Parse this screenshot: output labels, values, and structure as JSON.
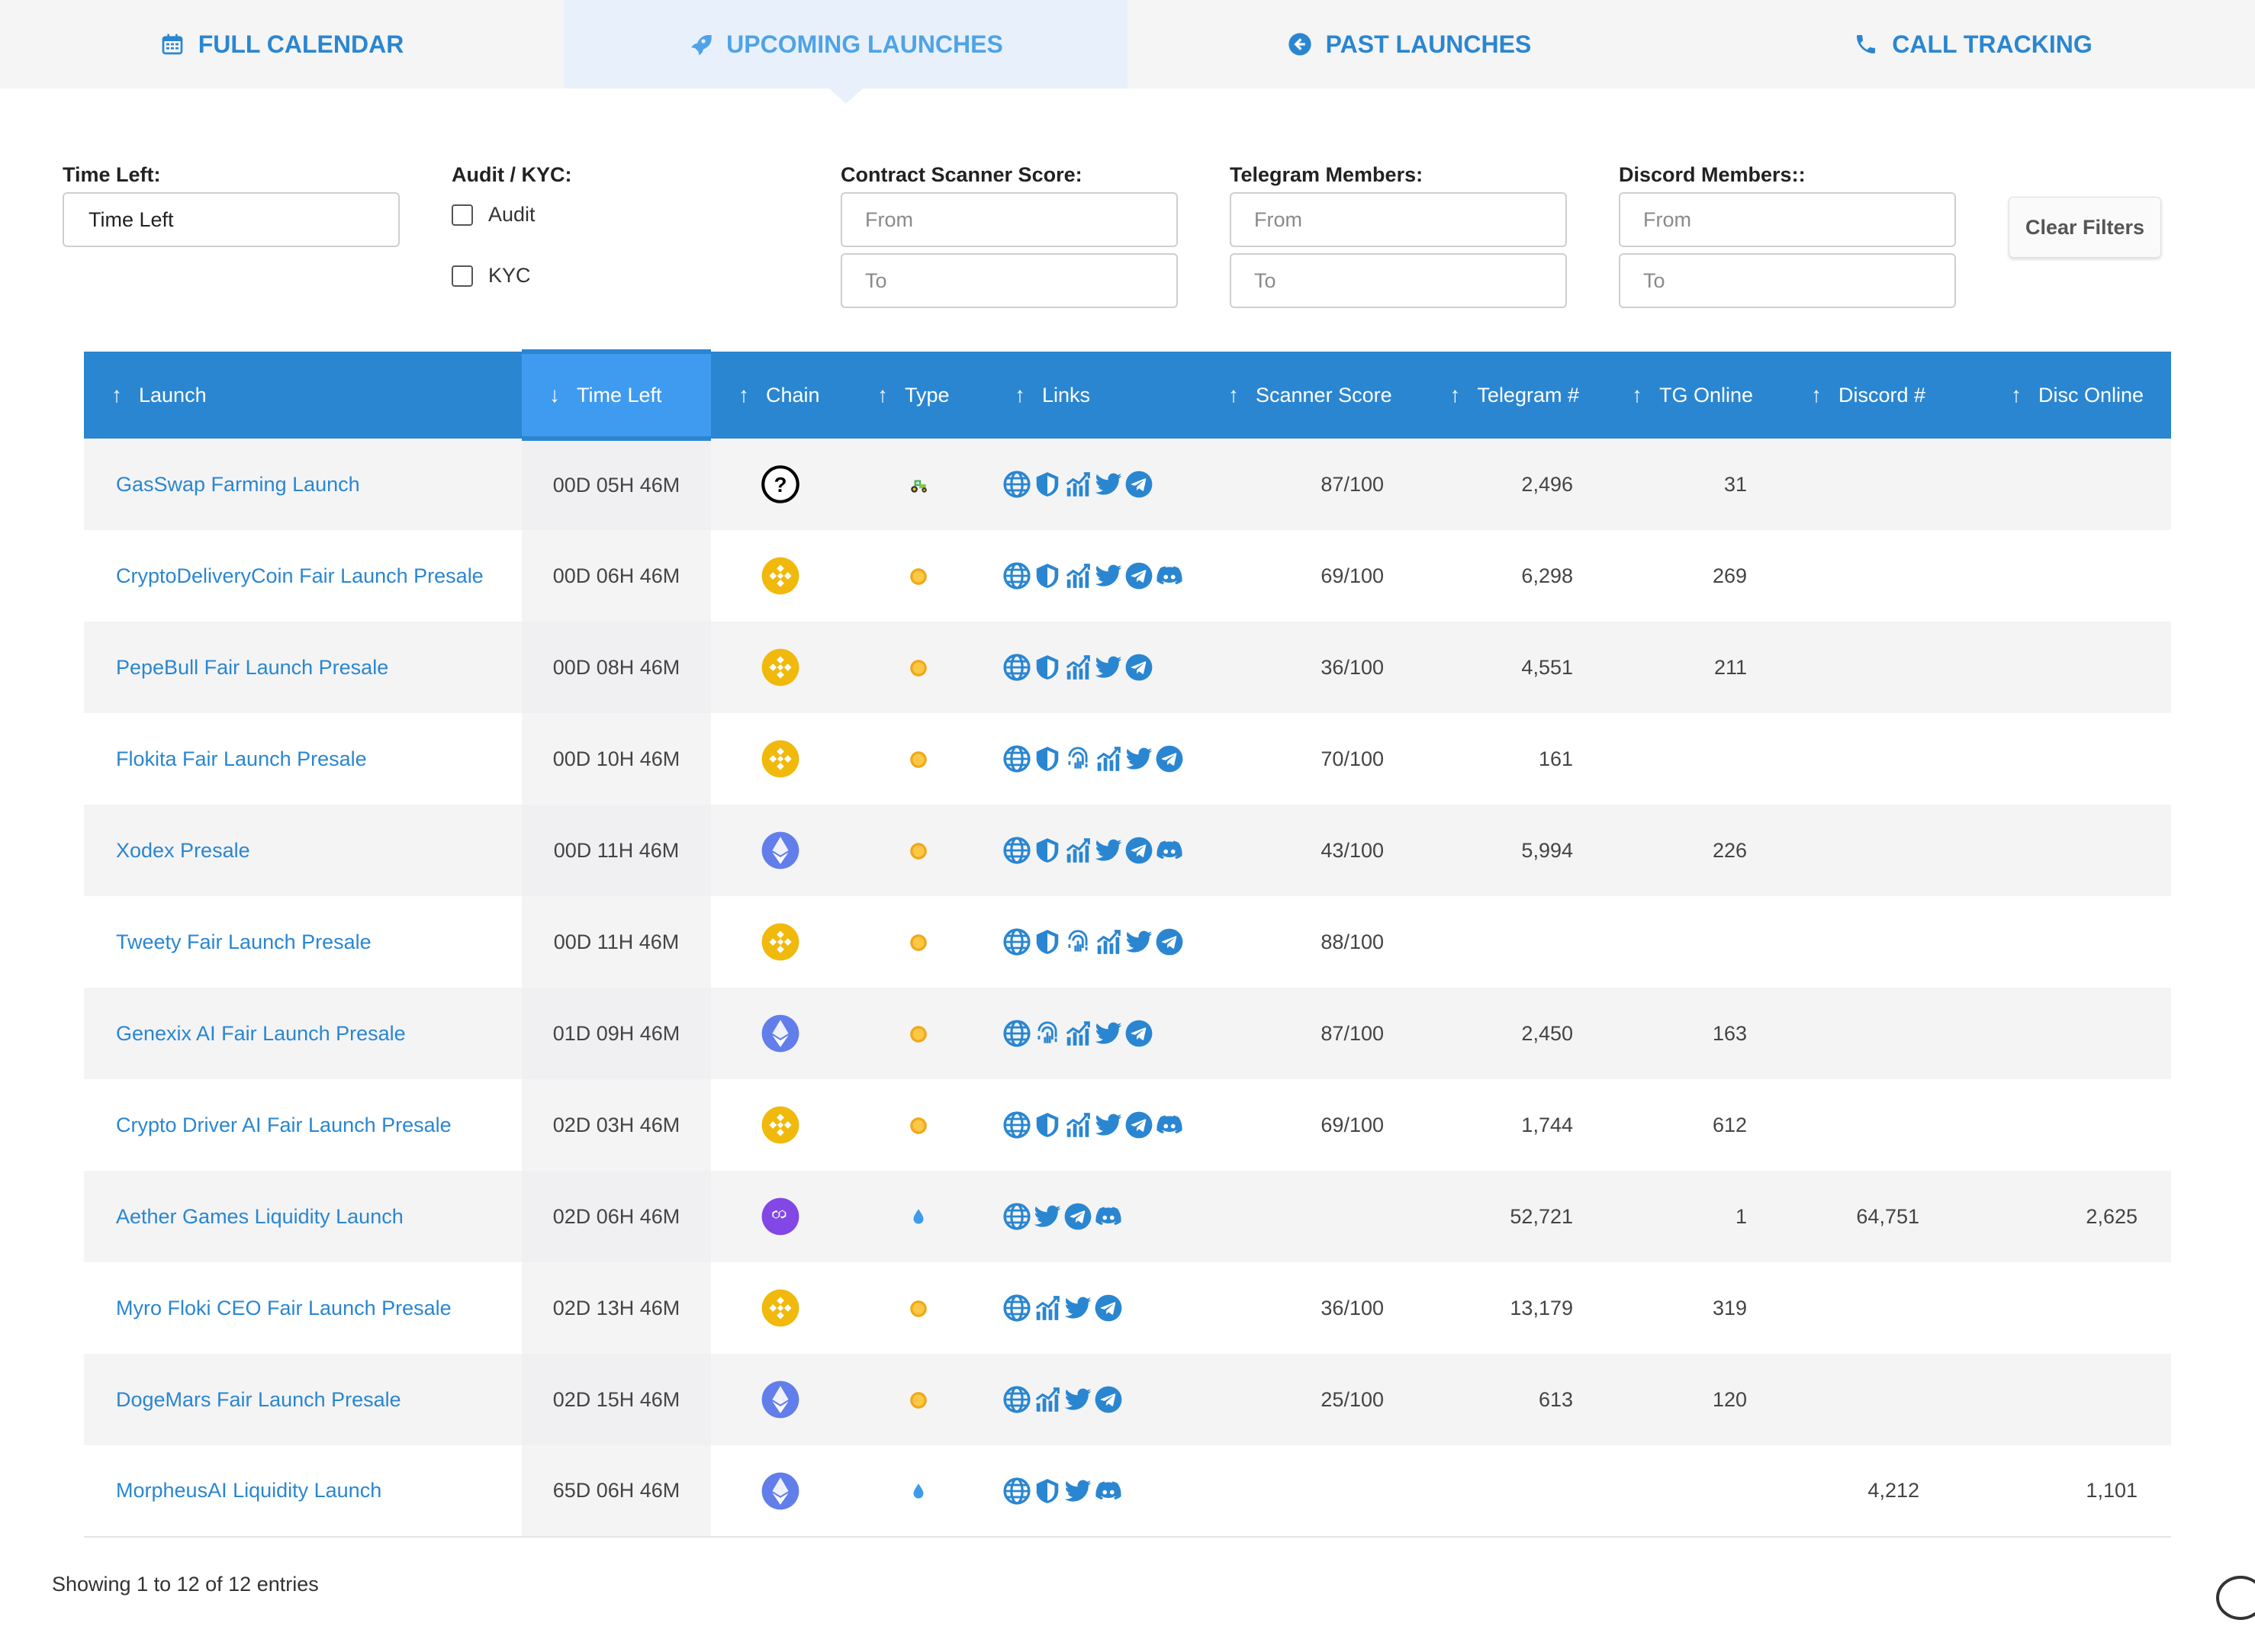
{
  "tabs": [
    {
      "label": "FULL CALENDAR",
      "icon": "calendar-icon",
      "active": false
    },
    {
      "label": "UPCOMING LAUNCHES",
      "icon": "rocket-icon",
      "active": true
    },
    {
      "label": "PAST LAUNCHES",
      "icon": "arrow-circle-left-icon",
      "active": false
    },
    {
      "label": "CALL TRACKING",
      "icon": "phone-icon",
      "active": false
    }
  ],
  "filters": {
    "time_left": {
      "label": "Time Left:",
      "value": "Time Left"
    },
    "audit_kyc": {
      "label": "Audit / KYC:",
      "audit": "Audit",
      "kyc": "KYC"
    },
    "scanner": {
      "label": "Contract Scanner Score:",
      "from_placeholder": "From",
      "to_placeholder": "To"
    },
    "telegram": {
      "label": "Telegram Members:",
      "from_placeholder": "From",
      "to_placeholder": "To"
    },
    "discord": {
      "label": "Discord Members::",
      "from_placeholder": "From",
      "to_placeholder": "To"
    },
    "clear": "Clear Filters"
  },
  "table": {
    "columns": [
      "Launch",
      "Time Left",
      "Chain",
      "Type",
      "Links",
      "Scanner Score",
      "Telegram #",
      "TG Online",
      "Discord #",
      "Disc Online"
    ],
    "sort_arrows": [
      "↑",
      "↓",
      "↑",
      "↑",
      "↑",
      "↑",
      "↑",
      "↑",
      "↑",
      "↑"
    ],
    "rows": [
      {
        "name": "GasSwap Farming Launch",
        "time": "00D 05H 46M",
        "chain": "unknown",
        "type": "farm",
        "links": [
          "globe",
          "shield",
          "chart",
          "twitter",
          "telegram"
        ],
        "score": "87/100",
        "tg": "2,496",
        "tg_online": "31",
        "discord": "",
        "disc_online": ""
      },
      {
        "name": "CryptoDeliveryCoin Fair Launch Presale",
        "time": "00D 06H 46M",
        "chain": "bnb",
        "type": "coin",
        "links": [
          "globe",
          "shield",
          "chart",
          "twitter",
          "telegram",
          "discord"
        ],
        "score": "69/100",
        "tg": "6,298",
        "tg_online": "269",
        "discord": "",
        "disc_online": ""
      },
      {
        "name": "PepeBull Fair Launch Presale",
        "time": "00D 08H 46M",
        "chain": "bnb",
        "type": "coin",
        "links": [
          "globe",
          "shield",
          "chart",
          "twitter",
          "telegram"
        ],
        "score": "36/100",
        "tg": "4,551",
        "tg_online": "211",
        "discord": "",
        "disc_online": ""
      },
      {
        "name": "Flokita Fair Launch Presale",
        "time": "00D 10H 46M",
        "chain": "bnb",
        "type": "coin",
        "links": [
          "globe",
          "shield",
          "fingerprint",
          "chart",
          "twitter",
          "telegram"
        ],
        "score": "70/100",
        "tg": "161",
        "tg_online": "",
        "discord": "",
        "disc_online": ""
      },
      {
        "name": "Xodex Presale",
        "time": "00D 11H 46M",
        "chain": "eth",
        "type": "coin",
        "links": [
          "globe",
          "shield",
          "chart",
          "twitter",
          "telegram",
          "discord"
        ],
        "score": "43/100",
        "tg": "5,994",
        "tg_online": "226",
        "discord": "",
        "disc_online": ""
      },
      {
        "name": "Tweety Fair Launch Presale",
        "time": "00D 11H 46M",
        "chain": "bnb",
        "type": "coin",
        "links": [
          "globe",
          "shield",
          "fingerprint",
          "chart",
          "twitter",
          "telegram"
        ],
        "score": "88/100",
        "tg": "",
        "tg_online": "",
        "discord": "",
        "disc_online": ""
      },
      {
        "name": "Genexix AI Fair Launch Presale",
        "time": "01D 09H 46M",
        "chain": "eth",
        "type": "coin",
        "links": [
          "globe",
          "fingerprint",
          "chart",
          "twitter",
          "telegram"
        ],
        "score": "87/100",
        "tg": "2,450",
        "tg_online": "163",
        "discord": "",
        "disc_online": ""
      },
      {
        "name": "Crypto Driver AI Fair Launch Presale",
        "time": "02D 03H 46M",
        "chain": "bnb",
        "type": "coin",
        "links": [
          "globe",
          "shield",
          "chart",
          "twitter",
          "telegram",
          "discord"
        ],
        "score": "69/100",
        "tg": "1,744",
        "tg_online": "612",
        "discord": "",
        "disc_online": ""
      },
      {
        "name": "Aether Games Liquidity Launch",
        "time": "02D 06H 46M",
        "chain": "polygon",
        "type": "drop",
        "links": [
          "globe",
          "twitter",
          "telegram",
          "discord"
        ],
        "score": "",
        "tg": "52,721",
        "tg_online": "1",
        "discord": "64,751",
        "disc_online": "2,625"
      },
      {
        "name": "Myro Floki CEO Fair Launch Presale",
        "time": "02D 13H 46M",
        "chain": "bnb",
        "type": "coin",
        "links": [
          "globe",
          "chart",
          "twitter",
          "telegram"
        ],
        "score": "36/100",
        "tg": "13,179",
        "tg_online": "319",
        "discord": "",
        "disc_online": ""
      },
      {
        "name": "DogeMars Fair Launch Presale",
        "time": "02D 15H 46M",
        "chain": "eth",
        "type": "coin",
        "links": [
          "globe",
          "chart",
          "twitter",
          "telegram"
        ],
        "score": "25/100",
        "tg": "613",
        "tg_online": "120",
        "discord": "",
        "disc_online": ""
      },
      {
        "name": "MorpheusAI Liquidity Launch",
        "time": "65D 06H 46M",
        "chain": "eth",
        "type": "drop",
        "links": [
          "globe",
          "shield",
          "twitter",
          "discord"
        ],
        "score": "",
        "tg": "",
        "tg_online": "",
        "discord": "4,212",
        "disc_online": "1,101"
      }
    ]
  },
  "footer": {
    "info": "Showing 1 to 12 of 12 entries"
  },
  "colors": {
    "accent": "#2a86d1",
    "header_sorted": "#3f9bf0",
    "bnb": "#f0b90b",
    "eth": "#627eea",
    "polygon": "#8247e5"
  }
}
